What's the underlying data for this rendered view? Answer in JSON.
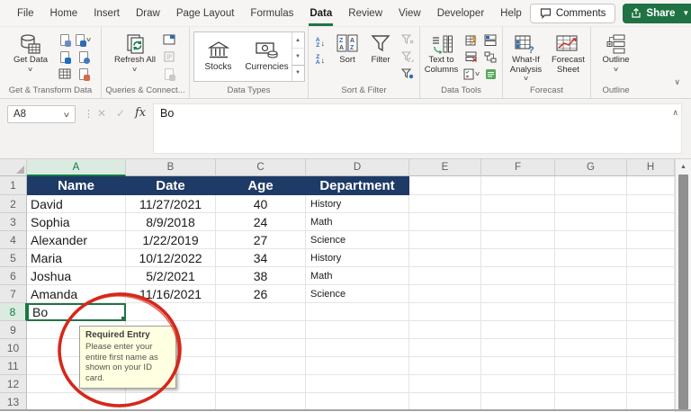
{
  "chrome": {
    "tabs": [
      {
        "label": "File"
      },
      {
        "label": "Home"
      },
      {
        "label": "Insert"
      },
      {
        "label": "Draw"
      },
      {
        "label": "Page Layout"
      },
      {
        "label": "Formulas"
      },
      {
        "label": "Data",
        "active": true
      },
      {
        "label": "Review"
      },
      {
        "label": "View"
      },
      {
        "label": "Developer"
      },
      {
        "label": "Help"
      }
    ],
    "comments_label": "Comments",
    "share_label": "Share"
  },
  "ribbon": {
    "get_transform": {
      "big_label": "Get Data",
      "group_label": "Get & Transform Data"
    },
    "queries": {
      "big_label": "Refresh All",
      "group_label": "Queries & Connect..."
    },
    "data_types": {
      "stocks_label": "Stocks",
      "currencies_label": "Currencies",
      "group_label": "Data Types"
    },
    "sort_filter": {
      "sort_label": "Sort",
      "filter_label": "Filter",
      "group_label": "Sort & Filter"
    },
    "data_tools": {
      "big_label": "Text to Columns",
      "group_label": "Data Tools"
    },
    "forecast": {
      "what_if_label": "What-If Analysis",
      "forecast_label": "Forecast Sheet",
      "group_label": "Forecast"
    },
    "outline": {
      "big_label": "Outline",
      "group_label": "Outline"
    }
  },
  "formula_bar": {
    "name_box": "A8",
    "content": "Bo"
  },
  "sheet": {
    "columns": [
      {
        "letter": "A",
        "width": 110,
        "selected": true
      },
      {
        "letter": "B",
        "width": 100
      },
      {
        "letter": "C",
        "width": 100
      },
      {
        "letter": "D",
        "width": 115
      },
      {
        "letter": "E",
        "width": 80
      },
      {
        "letter": "F",
        "width": 82
      },
      {
        "letter": "G",
        "width": 80
      },
      {
        "letter": "H",
        "width": 53
      }
    ],
    "rows": [
      {
        "n": 1,
        "kind": "header",
        "cells": [
          "Name",
          "Date",
          "Age",
          "Department"
        ]
      },
      {
        "n": 2,
        "kind": "data",
        "cells": [
          "David",
          "11/27/2021",
          "40",
          "History"
        ]
      },
      {
        "n": 3,
        "kind": "data",
        "cells": [
          "Sophia",
          "8/9/2018",
          "24",
          "Math"
        ]
      },
      {
        "n": 4,
        "kind": "data",
        "cells": [
          "Alexander",
          "1/22/2019",
          "27",
          "Science"
        ]
      },
      {
        "n": 5,
        "kind": "data",
        "cells": [
          "Maria",
          "10/12/2022",
          "34",
          "History"
        ]
      },
      {
        "n": 6,
        "kind": "data",
        "cells": [
          "Joshua",
          "5/2/2021",
          "38",
          "Math"
        ]
      },
      {
        "n": 7,
        "kind": "data",
        "cells": [
          "Amanda",
          "11/16/2021",
          "26",
          "Science"
        ]
      },
      {
        "n": 8,
        "kind": "active",
        "selected": true,
        "cells": [
          "Bo",
          "",
          "",
          ""
        ]
      },
      {
        "n": 9,
        "kind": "empty",
        "cells": []
      },
      {
        "n": 10,
        "kind": "empty",
        "cells": []
      },
      {
        "n": 11,
        "kind": "empty",
        "cells": []
      },
      {
        "n": 12,
        "kind": "empty",
        "cells": []
      },
      {
        "n": 13,
        "kind": "empty",
        "cells": []
      }
    ]
  },
  "validation_tooltip": {
    "title": "Required Entry",
    "body": "Please enter your entire first name as shown on your ID card."
  },
  "colors": {
    "accent_green": "#217346",
    "selected_header_green": "#107c41",
    "table_header_blue": "#1e3a66",
    "tooltip_yellow": "#ffffe1",
    "annotation_red": "#d5281b"
  }
}
